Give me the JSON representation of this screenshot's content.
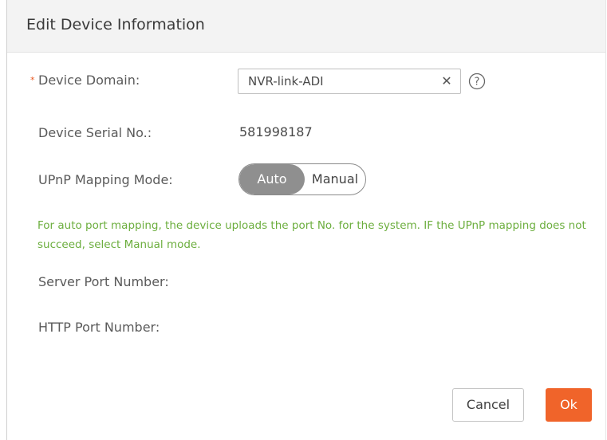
{
  "dialog": {
    "title": "Edit Device Information"
  },
  "form": {
    "required_mark": "*",
    "device_domain": {
      "label": "Device Domain:",
      "value": "NVR-link-ADI",
      "clear_icon": "close-icon",
      "help_icon": "help-icon"
    },
    "serial": {
      "label": "Device Serial No.:",
      "value": "581998187"
    },
    "upnp": {
      "label": "UPnP Mapping Mode:",
      "options": [
        "Auto",
        "Manual"
      ],
      "selected": "Auto"
    },
    "hint": "For auto port mapping, the device uploads the port No. for the system. IF the UPnP mapping does not succeed, select Manual mode.",
    "server_port": {
      "label": "Server Port Number:"
    },
    "http_port": {
      "label": "HTTP Port Number:"
    }
  },
  "actions": {
    "cancel_label": "Cancel",
    "ok_label": "Ok"
  },
  "colors": {
    "accent": "#f0642a",
    "hint": "#6cae3e",
    "toggle_active": "#8f8f8f"
  }
}
